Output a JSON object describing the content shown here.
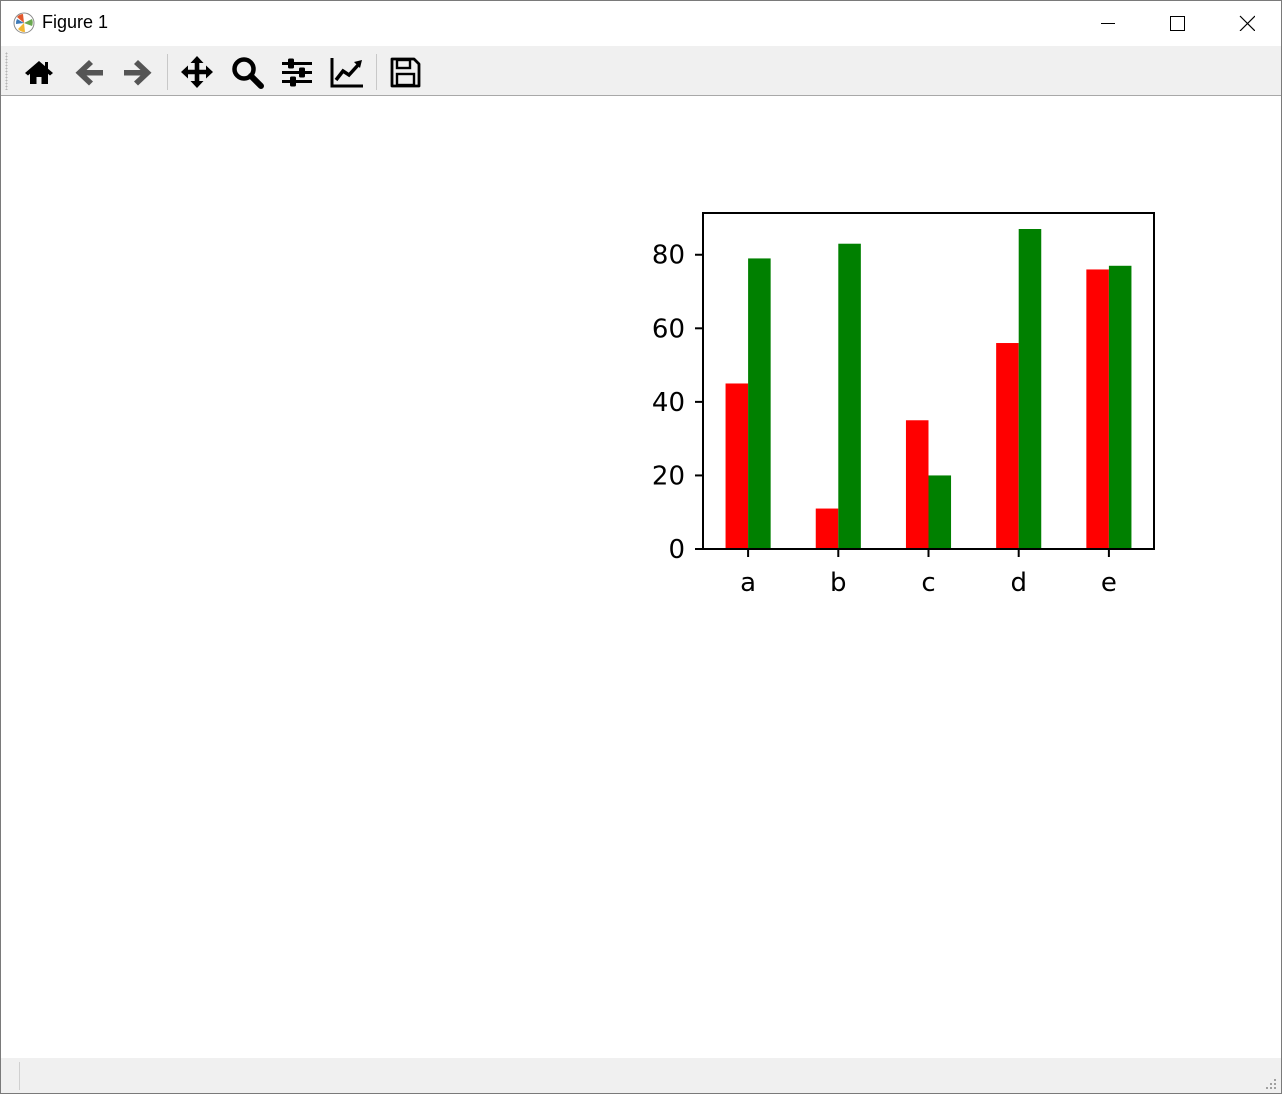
{
  "window": {
    "title": "Figure 1"
  },
  "toolbar": {
    "tools": [
      {
        "icon": "home-icon"
      },
      {
        "icon": "arrow-left-icon"
      },
      {
        "icon": "arrow-right-icon"
      },
      {
        "icon": "pan-icon"
      },
      {
        "icon": "zoom-icon"
      },
      {
        "icon": "sliders-icon"
      },
      {
        "icon": "line-chart-icon"
      },
      {
        "icon": "save-icon"
      }
    ]
  },
  "chart_data": {
    "type": "bar",
    "title": "",
    "xlabel": "",
    "ylabel": "",
    "categories": [
      "a",
      "b",
      "c",
      "d",
      "e"
    ],
    "series": [
      {
        "color": "#ff0000",
        "values": [
          45,
          11,
          35,
          56,
          76
        ]
      },
      {
        "color": "#008000",
        "values": [
          79,
          83,
          20,
          87,
          77
        ]
      }
    ],
    "ylim": [
      0,
      91.35
    ],
    "yticks": [
      0,
      20,
      40,
      60,
      80
    ],
    "ytick_labels": [
      "0",
      "20",
      "40",
      "60",
      "80"
    ],
    "grid": false,
    "legend": "none"
  }
}
